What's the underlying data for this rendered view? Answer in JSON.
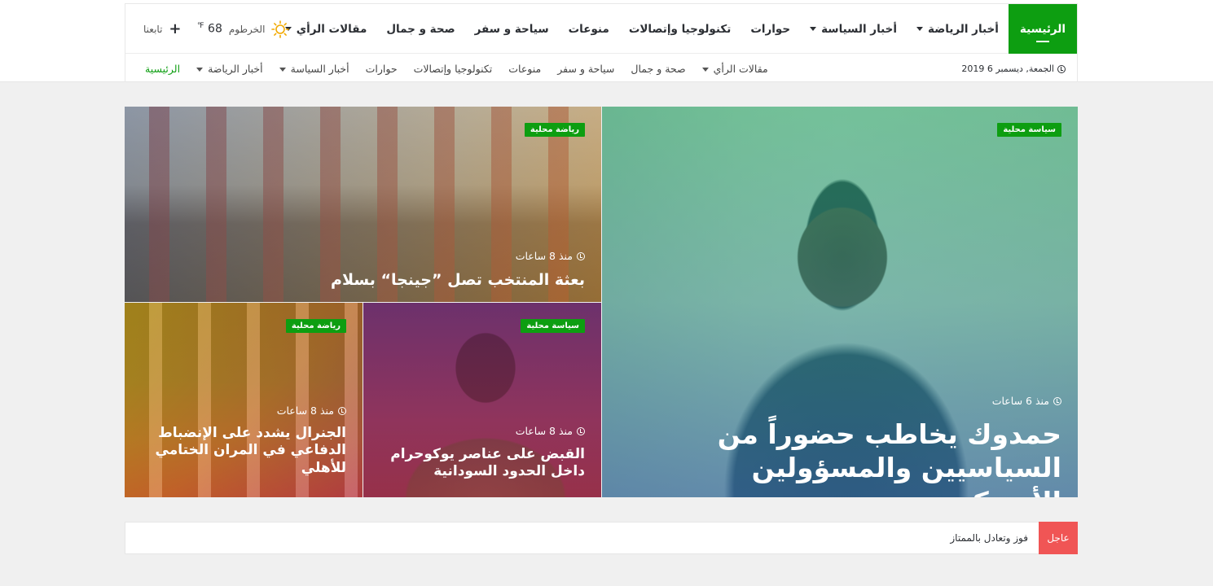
{
  "nav": {
    "items": [
      {
        "label": "الرئيسية",
        "active": true,
        "dropdown": false
      },
      {
        "label": "أخبار الرياضة",
        "active": false,
        "dropdown": true
      },
      {
        "label": "أخبار السياسة",
        "active": false,
        "dropdown": true
      },
      {
        "label": "حوارات",
        "active": false,
        "dropdown": false
      },
      {
        "label": "تكنولوجيا وإتصالات",
        "active": false,
        "dropdown": false
      },
      {
        "label": "منوعات",
        "active": false,
        "dropdown": false
      },
      {
        "label": "سياحة و سفر",
        "active": false,
        "dropdown": false
      },
      {
        "label": "صحة و جمال",
        "active": false,
        "dropdown": false
      },
      {
        "label": "مقالات الرأي",
        "active": false,
        "dropdown": true
      }
    ],
    "weather": {
      "city": "الخرطوم",
      "temp": "68",
      "unit": "℉",
      "icon": "sun-icon"
    },
    "follow": {
      "label": "تابعنا",
      "icon": "plus-icon"
    }
  },
  "subnav": {
    "date": "الجمعة, ديسمبر 6 2019",
    "items": [
      {
        "label": "الرئيسية",
        "active": true,
        "dropdown": false
      },
      {
        "label": "أخبار الرياضة",
        "active": false,
        "dropdown": true
      },
      {
        "label": "أخبار السياسة",
        "active": false,
        "dropdown": true
      },
      {
        "label": "حوارات",
        "active": false,
        "dropdown": false
      },
      {
        "label": "تكنولوجيا وإتصالات",
        "active": false,
        "dropdown": false
      },
      {
        "label": "منوعات",
        "active": false,
        "dropdown": false
      },
      {
        "label": "سياحة و سفر",
        "active": false,
        "dropdown": false
      },
      {
        "label": "صحة و جمال",
        "active": false,
        "dropdown": false
      },
      {
        "label": "مقالات الرأي",
        "active": false,
        "dropdown": true
      }
    ]
  },
  "featured": {
    "big": {
      "badge": "سياسة محلية",
      "time": "منذ 6 ساعات",
      "title": "حمدوك يخاطب حضوراً من السياسيين والمسؤولين الأمريكيين"
    },
    "top_left": {
      "badge": "رياضة محلية",
      "time": "منذ 8 ساعات",
      "title": "بعثة المنتخب تصل ”جينجا“ بسلام"
    },
    "bottom_middle": {
      "badge": "سياسة محلية",
      "time": "منذ 8 ساعات",
      "title": "القبض على عناصر يوكوحرام داخل الحدود السودانية"
    },
    "bottom_left": {
      "badge": "رياضة محلية",
      "time": "منذ 8 ساعات",
      "title": "الجنرال يشدد على الإنضباط الدفاعي في المران الختامي للأهلي"
    }
  },
  "ticker": {
    "label": "عاجل",
    "text": "فوز وتعادل بالممتاز"
  },
  "colors": {
    "accent": "#0d9e11",
    "breaking": "#f05555"
  }
}
